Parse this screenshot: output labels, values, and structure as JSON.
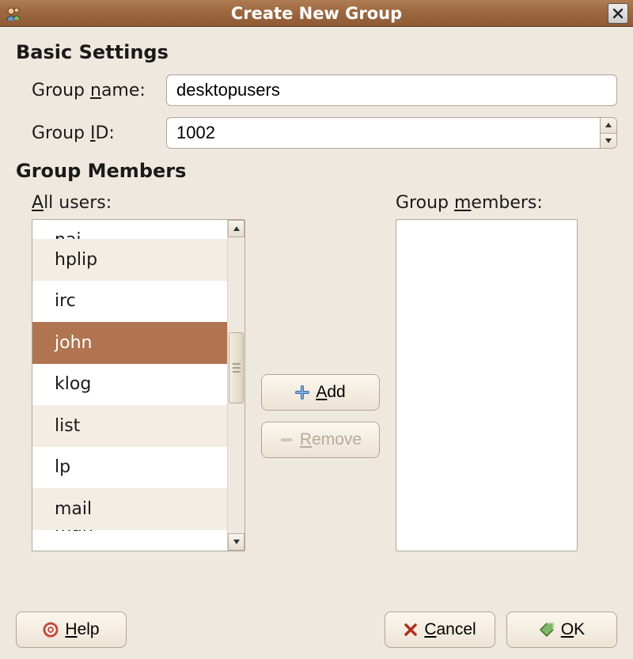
{
  "window": {
    "title": "Create New Group"
  },
  "sections": {
    "basic": "Basic Settings",
    "members": "Group Members"
  },
  "fields": {
    "name_label_pre": "Group ",
    "name_label_u": "n",
    "name_label_post": "ame:",
    "name_value": "desktopusers",
    "id_label_pre": "Group ",
    "id_label_u": "I",
    "id_label_post": "D:",
    "id_value": "1002"
  },
  "lists": {
    "all_label_u": "A",
    "all_label_post": "ll users:",
    "members_label_pre": "Group ",
    "members_label_u": "m",
    "members_label_post": "embers:",
    "all_users_visible": [
      "nai",
      "hplip",
      "irc",
      "john",
      "klog",
      "list",
      "lp",
      "mail",
      "man"
    ],
    "selected_user": "john"
  },
  "buttons": {
    "add_u": "A",
    "add_post": "dd",
    "remove_u": "R",
    "remove_post": "emove",
    "help_u": "H",
    "help_post": "elp",
    "cancel_u": "C",
    "cancel_post": "ancel",
    "ok_u": "O",
    "ok_post": "K"
  }
}
